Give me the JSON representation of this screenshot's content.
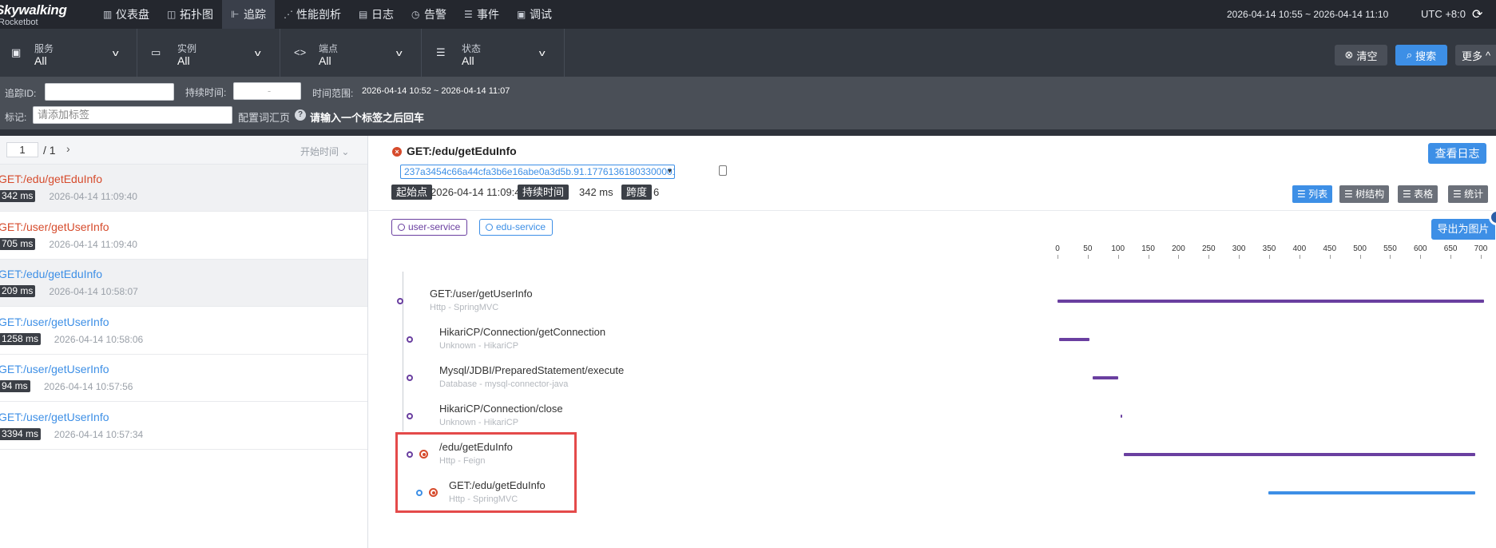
{
  "app": {
    "logo": "Skywalking",
    "logo_sub": "Rocketbot"
  },
  "nav": [
    {
      "label": "仪表盘",
      "icon": "dashboard-icon",
      "glyph": "▥"
    },
    {
      "label": "拓扑图",
      "icon": "topology-icon",
      "glyph": "◫"
    },
    {
      "label": "追踪",
      "icon": "trace-icon",
      "glyph": "⊩",
      "active": true
    },
    {
      "label": "性能剖析",
      "icon": "profile-icon",
      "glyph": "⋰"
    },
    {
      "label": "日志",
      "icon": "log-icon",
      "glyph": "▤"
    },
    {
      "label": "告警",
      "icon": "alarm-icon",
      "glyph": "◷"
    },
    {
      "label": "事件",
      "icon": "event-icon",
      "glyph": "☰"
    },
    {
      "label": "调试",
      "icon": "debug-icon",
      "glyph": "▣"
    }
  ],
  "header": {
    "time_range": "2026-04-14 10:55 ~ 2026-04-14 11:10",
    "timezone": "UTC +8:0"
  },
  "filters": [
    {
      "label": "服务",
      "value": "All",
      "icon": "service-icon"
    },
    {
      "label": "实例",
      "value": "All",
      "icon": "instance-icon"
    },
    {
      "label": "端点",
      "value": "All",
      "icon": "endpoint-icon"
    },
    {
      "label": "状态",
      "value": "All",
      "icon": "status-icon"
    }
  ],
  "actions": {
    "clear": "清空",
    "search": "搜索",
    "more": "更多"
  },
  "advanced": {
    "trace_id_label": "追踪ID:",
    "duration_label": "持续时间:",
    "duration_sep": "-",
    "time_range_label": "时间范围:",
    "time_range_value": "2026-04-14 10:52 ~ 2026-04-14 11:07",
    "tags_label": "标记:",
    "tags_placeholder": "请添加标签",
    "config_label": "配置词汇页",
    "help_text": "请输入一个标签之后回车"
  },
  "pager": {
    "page": "1",
    "total": "/ 1",
    "sort": "开始时间"
  },
  "traces": [
    {
      "name": "GET:/edu/getEduInfo",
      "duration": "342 ms",
      "time": "2026-04-14 11:09:40",
      "error": true,
      "selected": true
    },
    {
      "name": "GET:/user/getUserInfo",
      "duration": "705 ms",
      "time": "2026-04-14 11:09:40",
      "error": true
    },
    {
      "name": "GET:/edu/getEduInfo",
      "duration": "209 ms",
      "time": "2026-04-14 10:58:07",
      "error": false,
      "selected": true
    },
    {
      "name": "GET:/user/getUserInfo",
      "duration": "1258 ms",
      "time": "2026-04-14 10:58:06",
      "error": false
    },
    {
      "name": "GET:/user/getUserInfo",
      "duration": "94 ms",
      "time": "2026-04-14 10:57:56",
      "error": false
    },
    {
      "name": "GET:/user/getUserInfo",
      "duration": "3394 ms",
      "time": "2026-04-14 10:57:34",
      "error": false
    }
  ],
  "detail": {
    "title": "GET:/edu/getEduInfo",
    "view_log": "查看日志",
    "trace_id": "237a3454c66a44cfa3b6e16abe0a3d5b.91.17761361803300001",
    "start_label": "起始点",
    "start_value": "2026-04-14 11:09:40",
    "duration_label": "持续时间",
    "duration_value": "342 ms",
    "span_label": "跨度",
    "span_value": "6",
    "views": [
      {
        "label": "列表",
        "icon": "list-icon",
        "active": true
      },
      {
        "label": "树结构",
        "icon": "tree-icon",
        "active": false
      },
      {
        "label": "表格",
        "icon": "table-icon",
        "active": false
      },
      {
        "label": "统计",
        "icon": "stats-icon",
        "active": false
      }
    ],
    "services": [
      "user-service",
      "edu-service"
    ],
    "export": "导出为图片",
    "ruler": [
      "0",
      "50",
      "100",
      "150",
      "200",
      "250",
      "300",
      "350",
      "400",
      "450",
      "500",
      "550",
      "600",
      "650",
      "700"
    ],
    "spans": [
      {
        "name": "GET:/user/getUserInfo",
        "sub": "Http - SpringMVC",
        "level": 0,
        "start": 0,
        "end": 705,
        "color": "#6a3fa0",
        "service": "user-service",
        "error": false
      },
      {
        "name": "HikariCP/Connection/getConnection",
        "sub": "Unknown - HikariCP",
        "level": 1,
        "start": 2,
        "end": 53,
        "color": "#6a3fa0",
        "service": "user-service",
        "error": false
      },
      {
        "name": "Mysql/JDBI/PreparedStatement/execute",
        "sub": "Database - mysql-connector-java",
        "level": 1,
        "start": 58,
        "end": 101,
        "color": "#6a3fa0",
        "service": "user-service",
        "error": false
      },
      {
        "name": "HikariCP/Connection/close",
        "sub": "Unknown - HikariCP",
        "level": 1,
        "start": 104,
        "end": 106,
        "color": "#6a3fa0",
        "service": "user-service",
        "error": false
      },
      {
        "name": "/edu/getEduInfo",
        "sub": "Http - Feign",
        "level": 1,
        "start": 110,
        "end": 691,
        "color": "#6a3fa0",
        "service": "user-service",
        "error": true
      },
      {
        "name": "GET:/edu/getEduInfo",
        "sub": "Http - SpringMVC",
        "level": 2,
        "start": 349,
        "end": 691,
        "color": "#3d8fe6",
        "service": "edu-service",
        "error": true
      }
    ]
  },
  "colors": {
    "accent": "#3d8fe6",
    "error": "#d64b2c",
    "user_service": "#6a3fa0",
    "edu_service": "#3d8fe6",
    "topbar": "#24272e"
  }
}
